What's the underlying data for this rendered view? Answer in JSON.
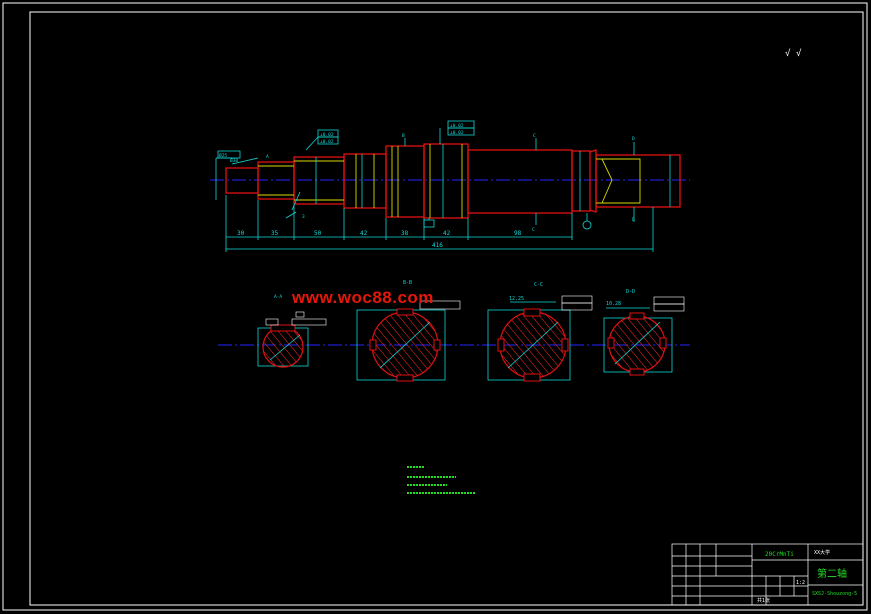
{
  "colors": {
    "background": "#000000",
    "frame": "#ffffff",
    "outline": "#e01010",
    "centerline": "#2323ff",
    "dimension": "#10d8d8",
    "note": "#22dd22",
    "hatch": "#ff2a2a",
    "watermark": "#e5170a"
  },
  "watermark": "www.woc88.com",
  "corner_mark": "√",
  "dimensions": {
    "segments": [
      "30",
      "35",
      "50",
      "42",
      "38",
      "42",
      "98"
    ],
    "total": "416"
  },
  "section_labels": {
    "b": "B-B",
    "c": "C-C",
    "d": "D-D"
  },
  "keyways": {
    "c": "12.25",
    "d": "10.28"
  },
  "title_block": {
    "material": "20CrMnTi",
    "school": "XX大学",
    "part_name": "第二轴",
    "scale": "1:2",
    "sheet": "共1张",
    "drawing_no": "SXSJ-Shouzong-5"
  }
}
